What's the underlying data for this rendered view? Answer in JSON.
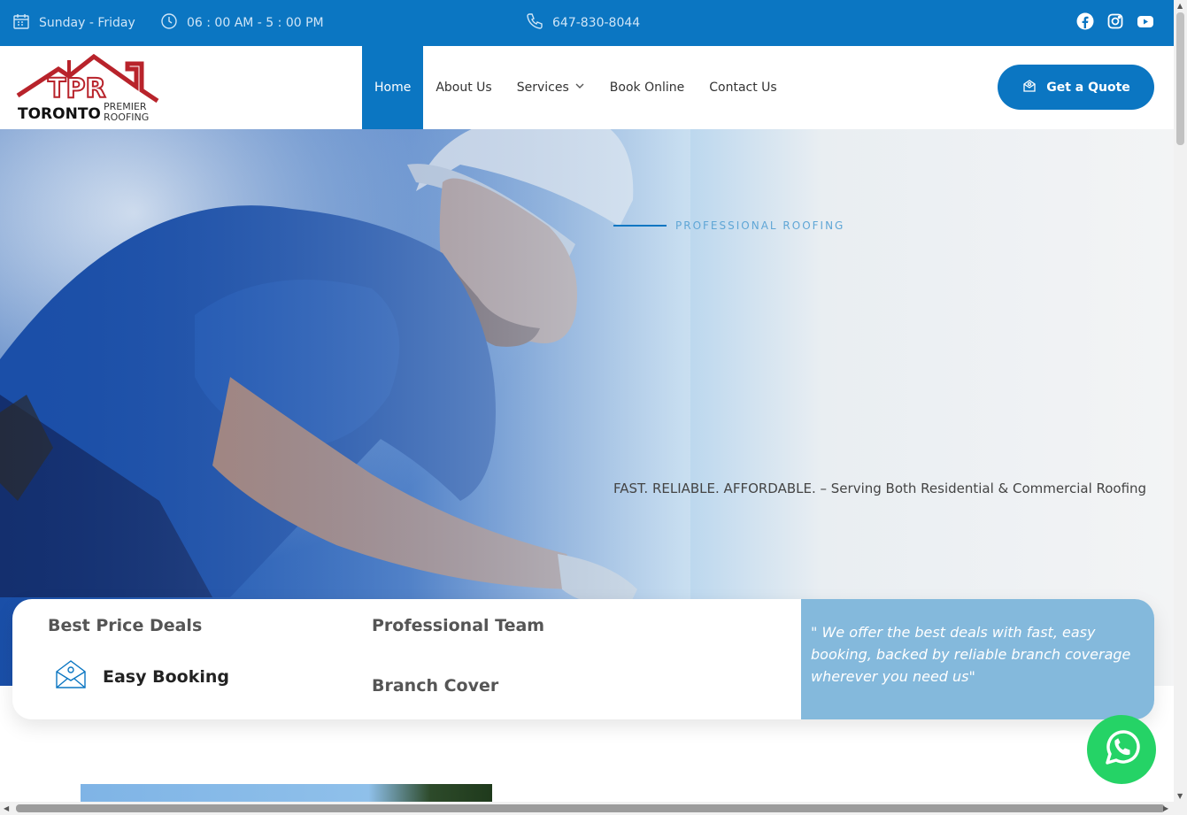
{
  "topbar": {
    "days": "Sunday - Friday",
    "hours": "06 : 00 AM - 5 : 00 PM",
    "phone": "647-830-8044",
    "social": [
      "facebook-icon",
      "instagram-icon",
      "youtube-icon"
    ]
  },
  "logo": {
    "letters": "TPR",
    "name_main": "TORONTO",
    "name_top": "PREMIER",
    "name_bottom": "ROOFING"
  },
  "nav": {
    "items": [
      {
        "label": "Home",
        "active": true
      },
      {
        "label": "About Us"
      },
      {
        "label": "Services",
        "has_dropdown": true
      },
      {
        "label": "Book Online"
      },
      {
        "label": "Contact Us"
      }
    ],
    "cta": "Get a Quote"
  },
  "hero": {
    "tagline": "PROFESSIONAL ROOFING",
    "subtitle": "FAST. RELIABLE. AFFORDABLE. – Serving Both Residential & Commercial Roofing"
  },
  "features": {
    "items": [
      "Best Price Deals",
      "Professional Team",
      "Easy Booking",
      "Branch Cover"
    ],
    "quote": "\" We offer the best deals with fast, easy booking, backed by reliable branch coverage wherever you need us\""
  },
  "colors": {
    "brand_blue": "#0b76c2",
    "logo_red": "#b8232b",
    "quote_bg": "#84b9dc",
    "whatsapp_green": "#25d366"
  }
}
